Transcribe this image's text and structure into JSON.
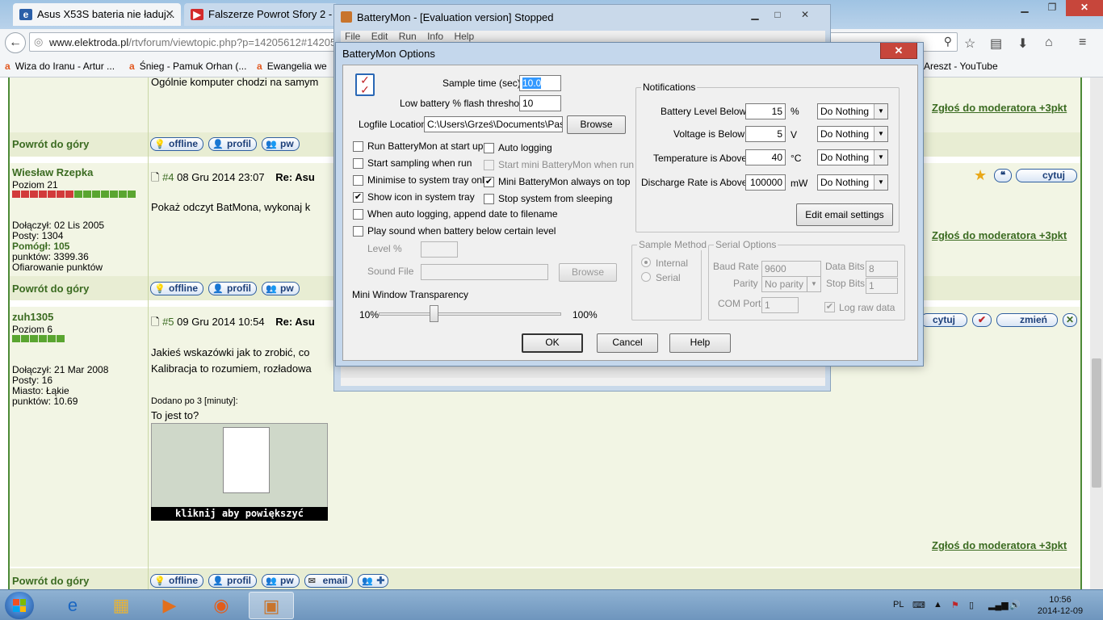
{
  "browser": {
    "tabs": [
      {
        "label": "Asus X53S bateria nie ładuj...",
        "active": true
      },
      {
        "label": "Falszerze Powrot Sfory 2 - ...",
        "active": false
      }
    ],
    "url_host": "www.elektroda.pl",
    "url_path": "/rtvforum/viewtopic.php?p=14205612#14205612",
    "bookmarks": [
      "Wiza do Iranu - Artur ...",
      "Śnieg - Pamuk Orhan (...",
      "Ewangelia we",
      "Areszt - YouTube"
    ],
    "icons": [
      "back-arrow-icon",
      "globe-icon",
      "search-icon",
      "star-icon",
      "reading-list-icon",
      "download-icon",
      "home-icon",
      "menu-icon"
    ]
  },
  "forum": {
    "top_text": "Ogólnie komputer chodzi na samym",
    "back_to_top": "Powrót do góry",
    "report": "Zgłoś do moderatora +3pkt",
    "buttons": {
      "offline": "offline",
      "profile": "profil",
      "pw": "pw",
      "email": "email",
      "quote": "cytuj",
      "edit": "zmień"
    },
    "posts": [
      {
        "username": "Wiesław Rzepka",
        "level": "Poziom 21",
        "joined": "Dołączył: 02 Lis 2005",
        "posts": "Posty: 1304",
        "helped": "Pomógł: 105",
        "points": "punktów: 3399.36",
        "donate": "Ofiarowanie punktów",
        "number": "#4",
        "date": "08 Gru 2014 23:07",
        "re": "Re: Asu",
        "text": "Pokaż odczyt BatMona, wykonaj k"
      },
      {
        "username": "zuh1305",
        "level": "Poziom 6",
        "joined": "Dołączył: 21 Mar 2008",
        "posts": "Posty: 16",
        "city": "Miasto: Łąkie",
        "points": "punktów: 10.69",
        "number": "#5",
        "date": "09 Gru 2014 10:54",
        "re": "Re: Asu",
        "line1": "Jakieś wskazówki jak to zrobić, co",
        "line2": "Kalibracja to rozumiem, rozładowa",
        "added": "Dodano po 3 [minuty]:",
        "question": "To jest to?",
        "thumb_caption": "kliknij aby powiększyć"
      }
    ]
  },
  "bm_window": {
    "title": "BatteryMon - [Evaluation version] Stopped",
    "menu": [
      "File",
      "Edit",
      "Run",
      "Info",
      "Help"
    ]
  },
  "dialog": {
    "title": "BatteryMon Options",
    "close": "✕",
    "sample_time_label": "Sample time (sec)",
    "sample_time_value": "10.0",
    "flash_threshold_label": "Low battery % flash threshold",
    "flash_threshold_value": "10",
    "logfile_label": "Logfile Location",
    "logfile_value": "C:\\Users\\Grześ\\Documents\\PassM",
    "browse": "Browse",
    "checkboxes": [
      {
        "label": "Run BatteryMon at start up",
        "checked": false,
        "disabled": false
      },
      {
        "label": "Start sampling when run",
        "checked": false,
        "disabled": false
      },
      {
        "label": "Minimise to system tray only",
        "checked": false,
        "disabled": false
      },
      {
        "label": "Show icon in system tray",
        "checked": true,
        "disabled": false
      },
      {
        "label": "When auto logging, append date to filename",
        "checked": false,
        "disabled": false
      },
      {
        "label": "Play sound when battery below certain level",
        "checked": false,
        "disabled": false
      },
      {
        "label": "Auto logging",
        "checked": false,
        "disabled": false
      },
      {
        "label": "Start mini BatteryMon when run",
        "checked": false,
        "disabled": true
      },
      {
        "label": "Mini BatteryMon always on top",
        "checked": true,
        "disabled": false
      },
      {
        "label": "Stop system from sleeping",
        "checked": false,
        "disabled": false
      }
    ],
    "level_label": "Level %",
    "sound_file_label": "Sound File",
    "transparency_label": "Mini Window Transparency",
    "transparency_min": "10%",
    "transparency_max": "100%",
    "transparency_value": 0.3,
    "notifications": {
      "title": "Notifications",
      "rows": [
        {
          "label": "Battery Level Below",
          "value": "15",
          "unit": "%",
          "action": "Do Nothing"
        },
        {
          "label": "Voltage is Below",
          "value": "5",
          "unit": "V",
          "action": "Do Nothing"
        },
        {
          "label": "Temperature is Above",
          "value": "40",
          "unit": "°C",
          "action": "Do Nothing"
        },
        {
          "label": "Discharge Rate is Above",
          "value": "100000",
          "unit": "mW",
          "action": "Do Nothing"
        }
      ],
      "email_button": "Edit email settings"
    },
    "sample_method": {
      "title": "Sample Method",
      "internal": "Internal",
      "serial": "Serial",
      "selected": "Internal"
    },
    "serial_options": {
      "title": "Serial Options",
      "baud_label": "Baud Rate",
      "baud_value": "9600",
      "data_bits_label": "Data Bits",
      "data_bits_value": "8",
      "parity_label": "Parity",
      "parity_value": "No parity",
      "stop_bits_label": "Stop Bits",
      "stop_bits_value": "1",
      "com_label": "COM Port",
      "com_value": "1",
      "log_raw_label": "Log raw data",
      "log_raw_checked": true
    },
    "ok": "OK",
    "cancel": "Cancel",
    "help": "Help"
  },
  "taskbar": {
    "language": "PL",
    "time": "10:56",
    "date": "2014-12-09",
    "items": [
      "internet-explorer-icon",
      "file-explorer-icon",
      "media-player-icon",
      "firefox-icon",
      "batterymon-icon"
    ]
  },
  "colors": {
    "forum_green": "#3b6b21",
    "forum_bg": "#f2f5e4",
    "dialog_frame": "#c4d7ec",
    "close_red": "#c7463b"
  }
}
